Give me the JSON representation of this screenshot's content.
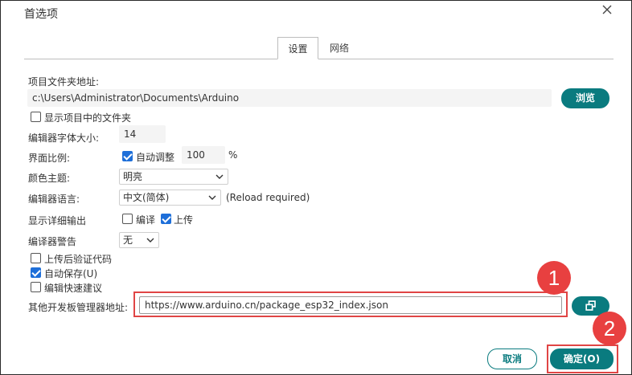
{
  "window": {
    "title": "首选项"
  },
  "tabs": {
    "settings": "设置",
    "network": "网络"
  },
  "sketchbook": {
    "label": "项目文件夹地址:",
    "path": "c:\\Users\\Administrator\\Documents\\Arduino",
    "browse_label": "浏览"
  },
  "show_files": {
    "label": "显示项目中的文件夹",
    "checked": false
  },
  "font_size": {
    "label": "编辑器字体大小:",
    "value": "14"
  },
  "scale": {
    "label": "界面比例:",
    "auto_label": "自动调整",
    "auto_checked": true,
    "value": "100",
    "unit": "%"
  },
  "theme": {
    "label": "颜色主题:",
    "value": "明亮"
  },
  "language": {
    "label": "编辑器语言:",
    "value": "中文(简体)",
    "note": "(Reload required)"
  },
  "verbose": {
    "label": "显示详细输出",
    "compile_label": "编译",
    "compile_checked": false,
    "upload_label": "上传",
    "upload_checked": true
  },
  "warnings": {
    "label": "编译器警告",
    "value": "无"
  },
  "verify_upload": {
    "label": "上传后验证代码",
    "checked": false
  },
  "auto_save": {
    "label": "自动保存(U)",
    "checked": true
  },
  "quick_suggest": {
    "label": "编辑快速建议",
    "checked": false
  },
  "board_urls": {
    "label": "其他开发板管理器地址:",
    "value": "https://www.arduino.cn/package_esp32_index.json"
  },
  "buttons": {
    "cancel": "取消",
    "ok": "确定(O)"
  },
  "annotations": {
    "step1": "1",
    "step2": "2"
  },
  "colors": {
    "accent": "#0a7b7f",
    "highlight": "#e04545",
    "checkbox": "#1e6fd9"
  }
}
